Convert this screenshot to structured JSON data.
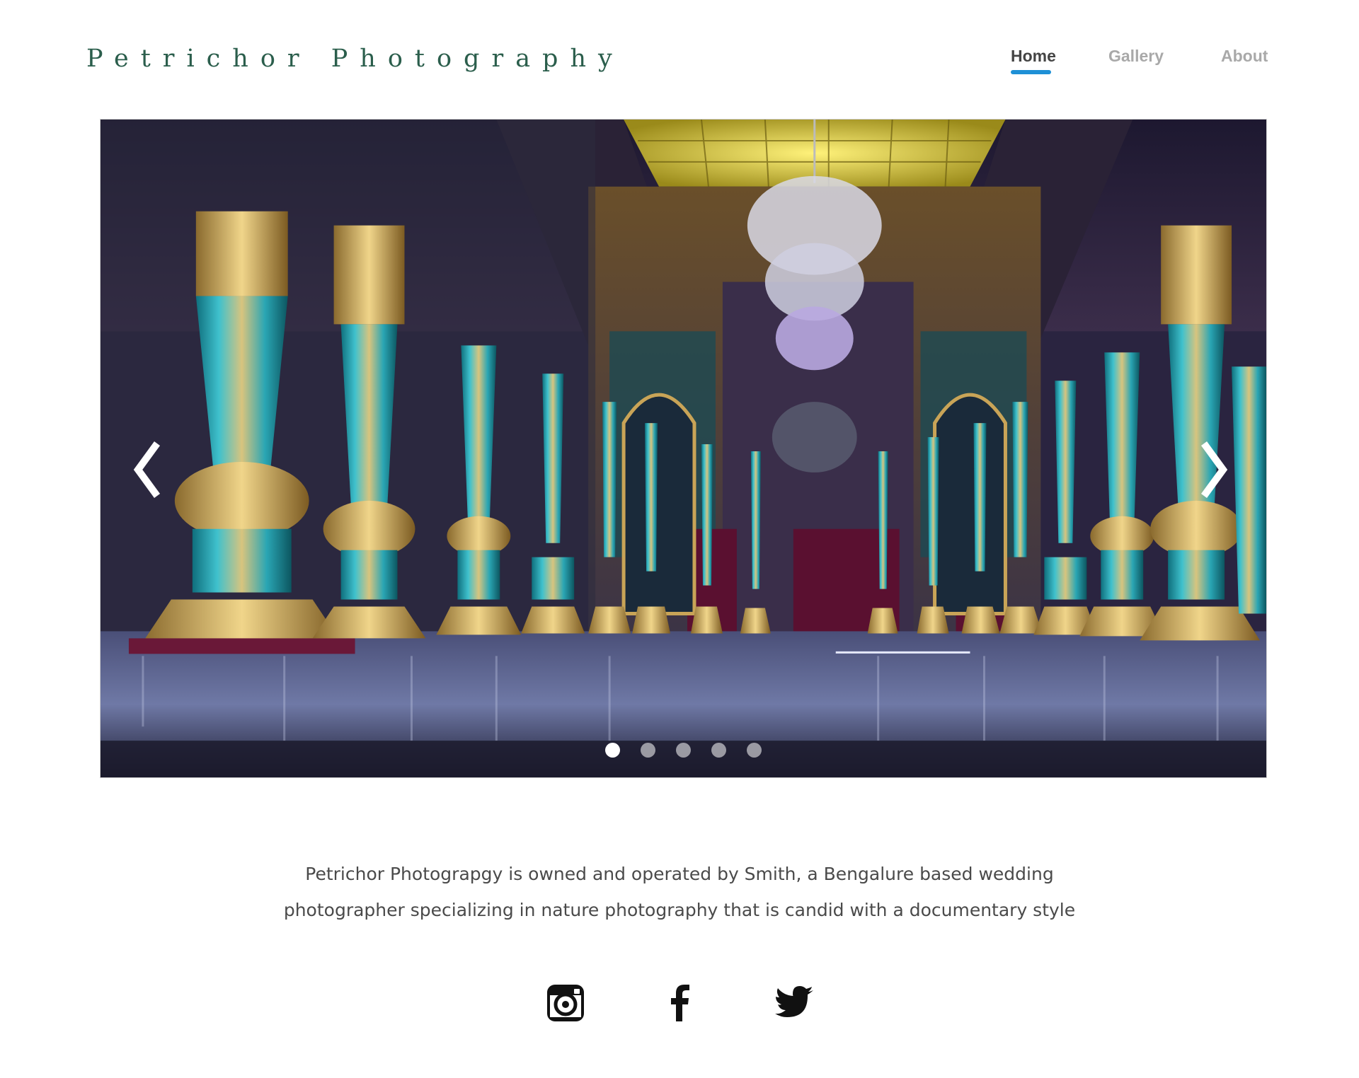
{
  "header": {
    "brand": "Petrichor Photography"
  },
  "nav": {
    "items": [
      {
        "label": "Home",
        "active": true
      },
      {
        "label": "Gallery",
        "active": false
      },
      {
        "label": "About",
        "active": false
      }
    ],
    "accent_color": "#1e90d6"
  },
  "carousel": {
    "prev_icon": "chevron-left-icon",
    "next_icon": "chevron-right-icon",
    "slide_count": 5,
    "active_slide": 1
  },
  "about": {
    "line1": "Petrichor Photograpgy is owned and operated by Smith, a Bengalure based wedding",
    "line2": "photographer specializing in nature photography that is candid with a documentary style"
  },
  "social": {
    "icons": [
      "instagram-icon",
      "facebook-icon",
      "twitter-icon"
    ]
  }
}
